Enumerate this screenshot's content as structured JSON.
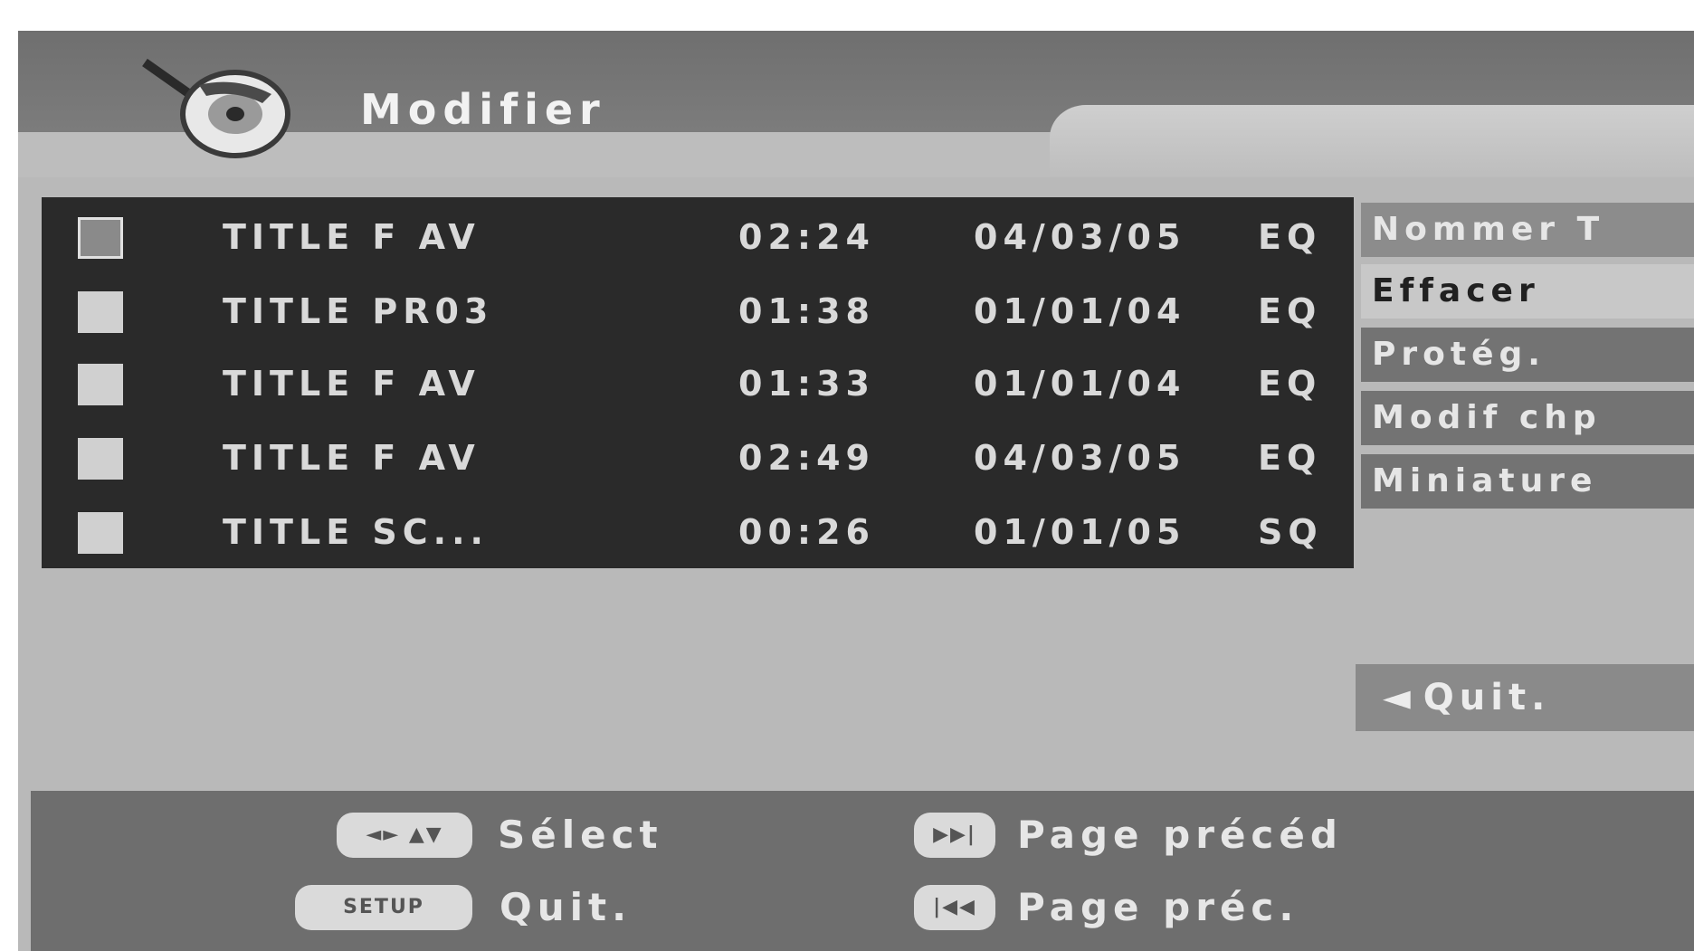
{
  "header": {
    "title": "Modifier"
  },
  "list": {
    "rows": [
      {
        "name": "TITLE F AV",
        "duration": "02:24",
        "date": "04/03/05",
        "quality": "EQ",
        "checked": true
      },
      {
        "name": "TITLE PR03",
        "duration": "01:38",
        "date": "01/01/04",
        "quality": "EQ",
        "checked": false
      },
      {
        "name": "TITLE F AV",
        "duration": "01:33",
        "date": "01/01/04",
        "quality": "EQ",
        "checked": false
      },
      {
        "name": "TITLE F AV",
        "duration": "02:49",
        "date": "04/03/05",
        "quality": "EQ",
        "checked": false
      },
      {
        "name": "TITLE SC...",
        "duration": "00:26",
        "date": "01/01/05",
        "quality": "SQ",
        "checked": false
      }
    ]
  },
  "menu": {
    "items": [
      {
        "label": "Nommer T"
      },
      {
        "label": "Effacer"
      },
      {
        "label": "Protég."
      },
      {
        "label": "Modif chp"
      },
      {
        "label": "Miniature"
      }
    ],
    "selected_index": 1,
    "quit_label": "Quit.",
    "quit_arrow": "◄"
  },
  "footer": {
    "select_key": "◄► ▲▼",
    "select_label": "Sélect",
    "setup_key": "SETUP",
    "setup_label": "Quit.",
    "next_key": "▶▶|",
    "next_label": "Page précéd",
    "prev_key": "|◀◀",
    "prev_label": "Page préc."
  }
}
